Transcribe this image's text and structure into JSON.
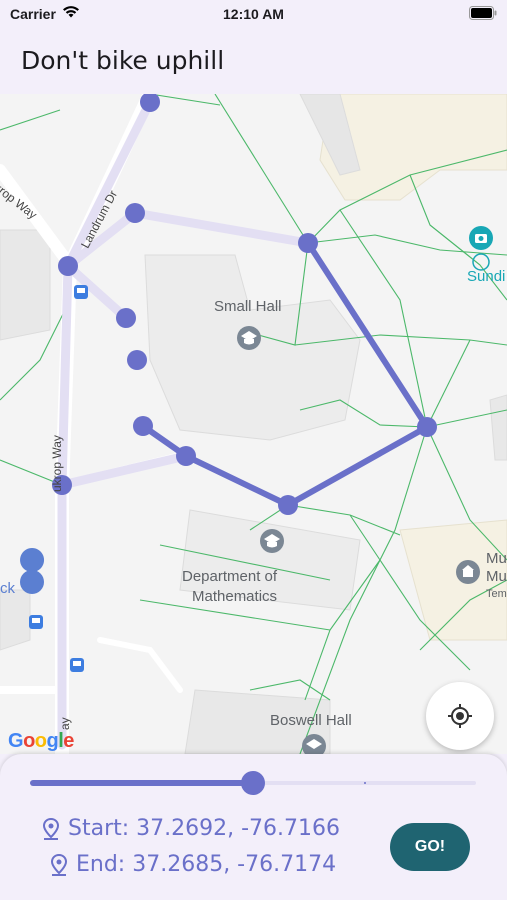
{
  "status_bar": {
    "carrier": "Carrier",
    "time": "12:10 AM",
    "icons": [
      "wifi-icon",
      "battery-icon"
    ]
  },
  "app_bar": {
    "title": "Don't bike uphill"
  },
  "map": {
    "labels": {
      "small_hall": "Small Hall",
      "dept_math_line1": "Department of",
      "dept_math_line2": "Mathematics",
      "boswell_hall": "Boswell Hall",
      "sundial": "Sundi",
      "mu_line1": "Mu",
      "mu_line2": "Mu",
      "tem": "Tem",
      "ck": "ck"
    },
    "roads": {
      "landrum": "Landrum Dr",
      "krop_way_top": "krop Way",
      "krop_way_vertical": "ukrop Way",
      "bottom_way": "ay"
    },
    "logo": "Google",
    "colors": {
      "route_main": "#6a70c9",
      "route_alt": "#e3dff3",
      "paths": "#4cb86a"
    }
  },
  "locate_button": {
    "icon": "my-location-icon"
  },
  "panel": {
    "slider_value": 0.5,
    "start_label": "Start: 37.2692, -76.7166",
    "end_label": "End: 37.2685, -76.7174",
    "go_label": "GO!"
  }
}
